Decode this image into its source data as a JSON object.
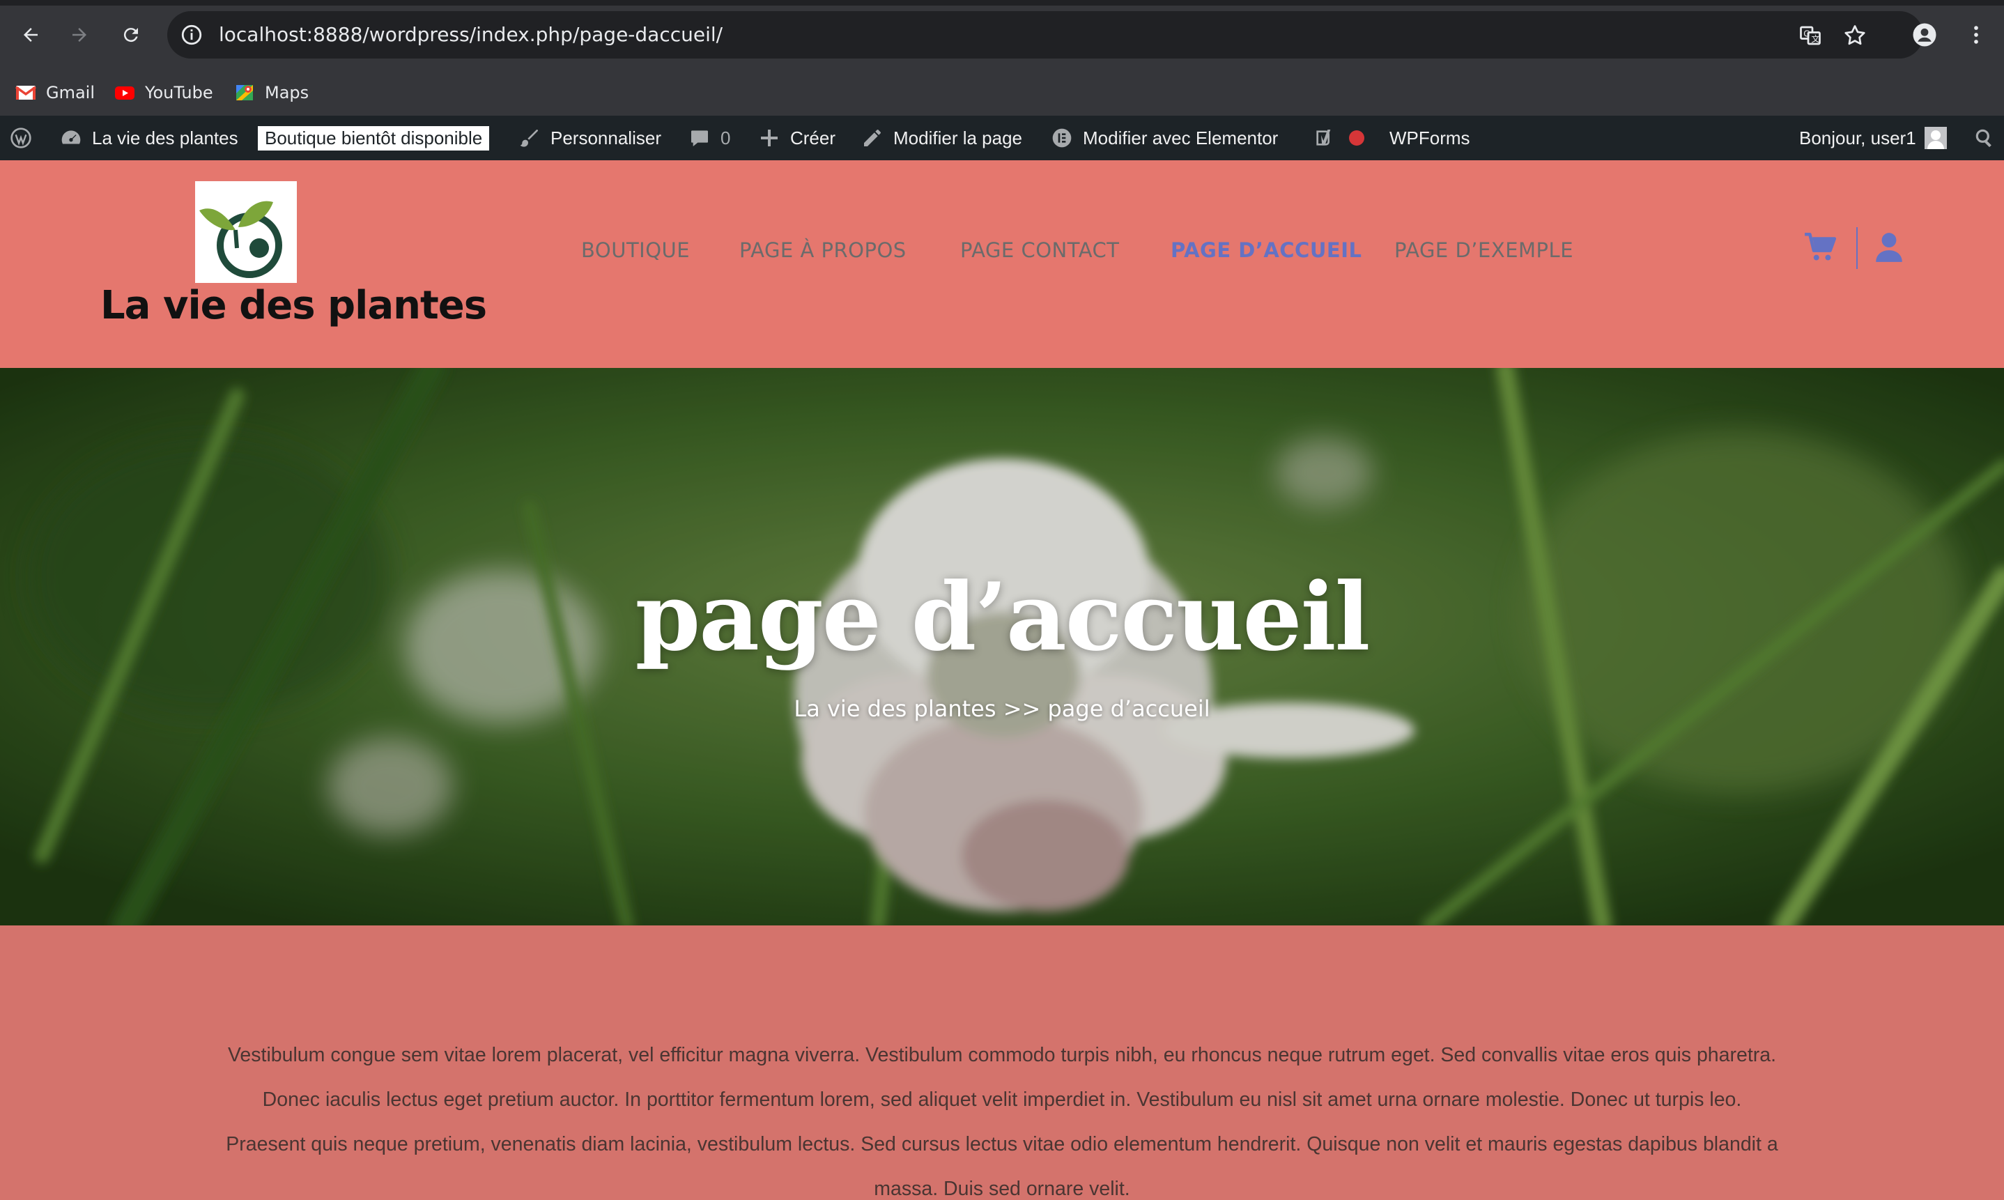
{
  "browser": {
    "url": "localhost:8888/wordpress/index.php/page-daccueil/",
    "bookmarks": [
      {
        "label": "Gmail",
        "icon": "gmail-icon"
      },
      {
        "label": "YouTube",
        "icon": "youtube-icon"
      },
      {
        "label": "Maps",
        "icon": "maps-icon"
      }
    ]
  },
  "admin_bar": {
    "site_name": "La vie des plantes",
    "store_badge": "Boutique bientôt disponible",
    "customize": "Personnaliser",
    "comments_count": "0",
    "new": "Créer",
    "edit_page": "Modifier la page",
    "edit_elementor": "Modifier avec Elementor",
    "wpforms": "WPForms",
    "greeting": "Bonjour, user1"
  },
  "header": {
    "site_title": "La vie des plantes",
    "menu": [
      {
        "label": "BOUTIQUE",
        "active": false
      },
      {
        "label": "PAGE À PROPOS",
        "active": false
      },
      {
        "label": "PAGE CONTACT",
        "active": false
      },
      {
        "label": "PAGE D’ACCUEIL",
        "active": true
      },
      {
        "label": "PAGE D’EXEMPLE",
        "active": false
      }
    ],
    "accent_color": "#6472c4",
    "background_color": "#e5776e"
  },
  "hero": {
    "title": "page d’accueil",
    "breadcrumb": "La vie des plantes >> page d’accueil"
  },
  "content": {
    "paragraph": "Vestibulum congue sem vitae lorem placerat, vel efficitur magna viverra. Vestibulum commodo turpis nibh, eu rhoncus neque rutrum eget. Sed convallis vitae eros quis pharetra. Donec iaculis lectus eget pretium auctor. In porttitor fermentum lorem, sed aliquet velit imperdiet in. Vestibulum eu nisl sit amet urna ornare molestie. Donec ut turpis leo. Praesent quis neque pretium, venenatis diam lacinia, vestibulum lectus. Sed cursus lectus vitae odio elementum hendrerit. Quisque non velit et mauris egestas dapibus blandit a massa. Duis sed ornare velit.",
    "background_color": "#d4736c"
  }
}
